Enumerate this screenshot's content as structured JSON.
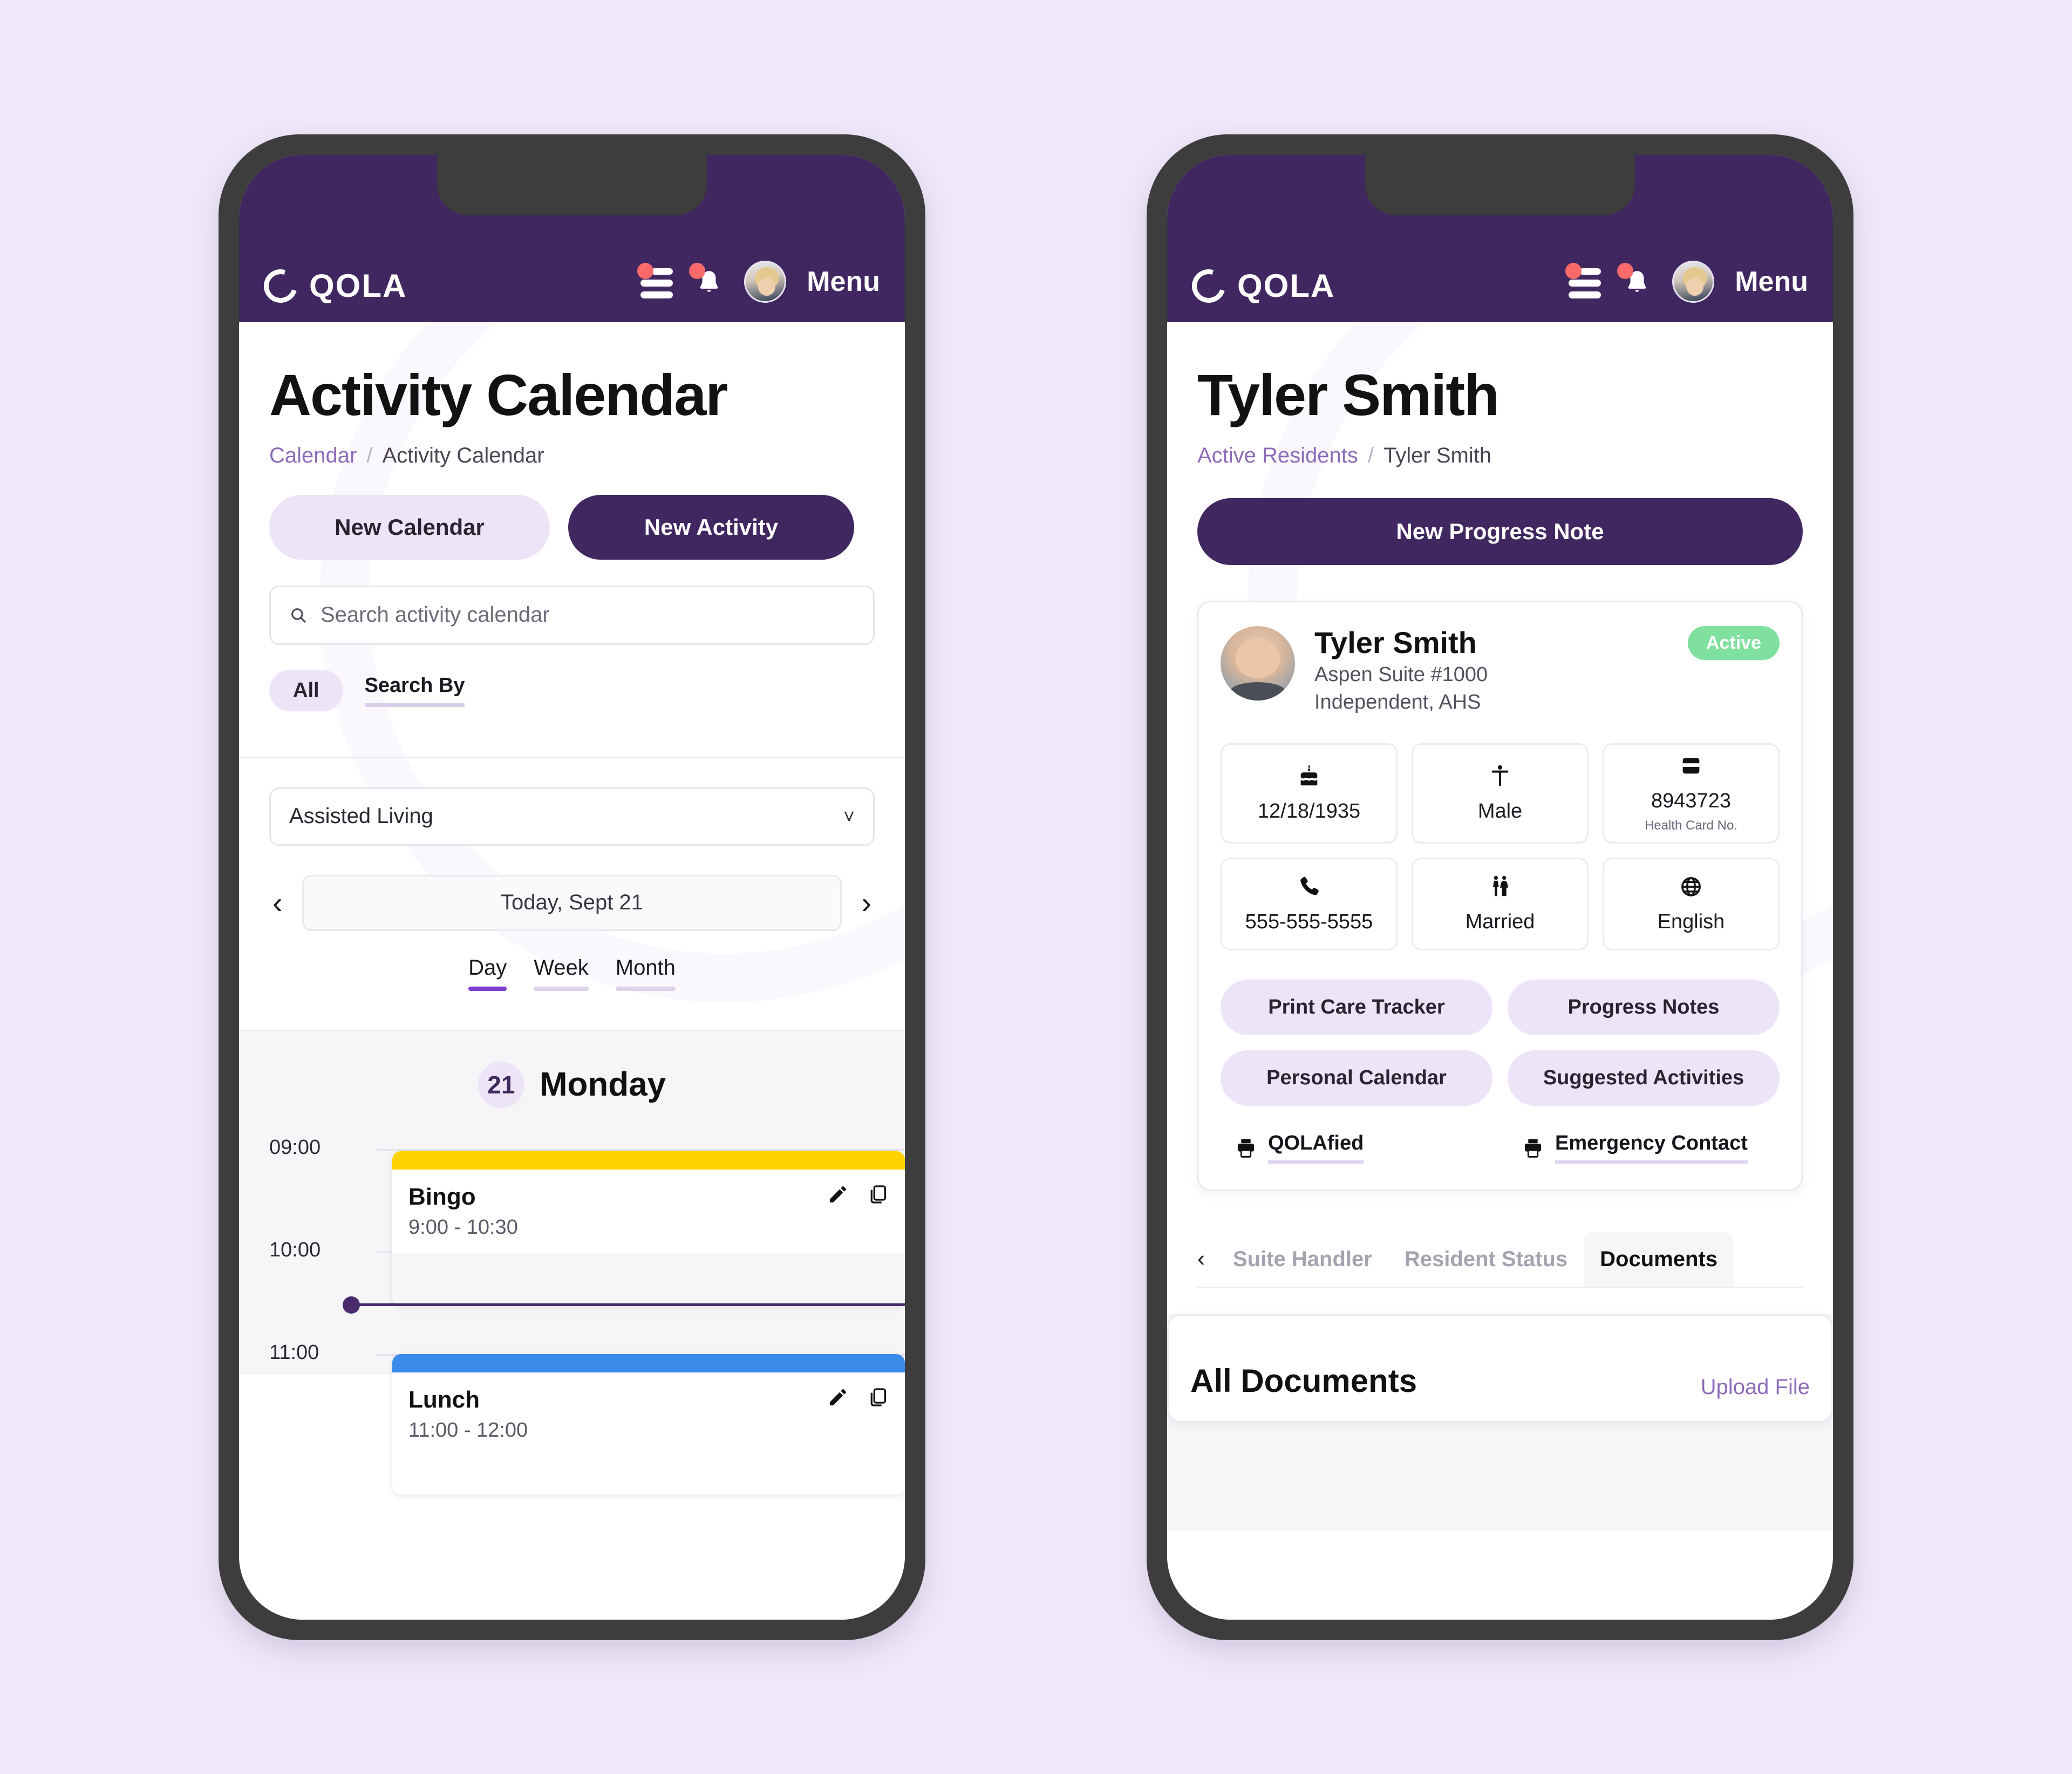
{
  "brand": {
    "name": "QOLA",
    "menu_label": "Menu"
  },
  "icons": {
    "tasks": "tasks-list-icon",
    "bell": "notification-bell-icon",
    "avatar": "user-avatar",
    "search": "search-icon",
    "chevron_down": "chevron-down-icon",
    "prev": "chevron-left-icon",
    "next": "chevron-right-icon",
    "edit": "pencil-edit-icon",
    "duplicate": "copy-duplicate-icon",
    "printer": "printer-icon",
    "cake": "birthday-cake-icon",
    "person": "person-icon",
    "card": "health-card-icon",
    "phone": "phone-icon",
    "couple": "married-couple-icon",
    "globe": "globe-language-icon"
  },
  "colors": {
    "brand_purple": "#402760",
    "soft_purple": "#EDE4F7",
    "link_purple": "#8D6BB8",
    "page_bg": "#EFE8F9",
    "accent_active": "#7B3FD0",
    "status_green": "#7FE0A0",
    "event_yellow": "#FFD200",
    "event_blue": "#3B8BEA",
    "now_line": "#4A2C6E",
    "badge_red": "#FB6A6A"
  },
  "left_phone": {
    "title": "Activity Calendar",
    "breadcrumb": {
      "parent": "Calendar",
      "separator": "/",
      "current": "Activity Calendar"
    },
    "actions": {
      "new_calendar": "New Calendar",
      "new_activity": "New Activity"
    },
    "search": {
      "value": "",
      "placeholder": "Search activity calendar"
    },
    "filters": {
      "all": "All",
      "search_by": "Search By"
    },
    "unit_select": {
      "value": "Assisted Living"
    },
    "date_nav": {
      "label": "Today, Sept 21"
    },
    "view_tabs": [
      {
        "label": "Day",
        "active": true
      },
      {
        "label": "Week",
        "active": false
      },
      {
        "label": "Month",
        "active": false
      }
    ],
    "day_header": {
      "date_number": "21",
      "day_name": "Monday"
    },
    "time_labels": [
      "09:00",
      "10:00",
      "11:00"
    ],
    "events": [
      {
        "title": "Bingo",
        "time": "9:00 - 10:30",
        "color": "#FFD200"
      },
      {
        "title": "Lunch",
        "time": "11:00 - 12:00",
        "color": "#3B8BEA"
      }
    ]
  },
  "right_phone": {
    "title": "Tyler Smith",
    "breadcrumb": {
      "parent": "Active Residents",
      "separator": "/",
      "current": "Tyler Smith"
    },
    "primary_action": "New Progress Note",
    "resident": {
      "name": "Tyler Smith",
      "suite": "Aspen Suite #1000",
      "care_level": "Independent, AHS",
      "status": "Active"
    },
    "info_tiles": [
      {
        "icon": "birthday-cake-icon",
        "glyph": "🎂",
        "value": "12/18/1935",
        "sub": ""
      },
      {
        "icon": "person-icon",
        "glyph": "🚹",
        "value": "Male",
        "sub": ""
      },
      {
        "icon": "health-card-icon",
        "glyph": "💳",
        "value": "8943723",
        "sub": "Health Card No."
      },
      {
        "icon": "phone-icon",
        "glyph": "📞",
        "value": "555-555-5555",
        "sub": ""
      },
      {
        "icon": "married-couple-icon",
        "glyph": "🚻",
        "value": "Married",
        "sub": ""
      },
      {
        "icon": "globe-language-icon",
        "glyph": "🌐",
        "value": "English",
        "sub": ""
      }
    ],
    "action_chips": [
      "Print Care Tracker",
      "Progress Notes",
      "Personal Calendar",
      "Suggested Activities"
    ],
    "print_links": [
      "QOLAfied",
      "Emergency Contact"
    ],
    "tabs": [
      {
        "label": "Suite Handler",
        "active": false
      },
      {
        "label": "Resident Status",
        "active": false
      },
      {
        "label": "Documents",
        "active": true
      }
    ],
    "documents_panel": {
      "title": "All Documents",
      "upload": "Upload File"
    }
  }
}
